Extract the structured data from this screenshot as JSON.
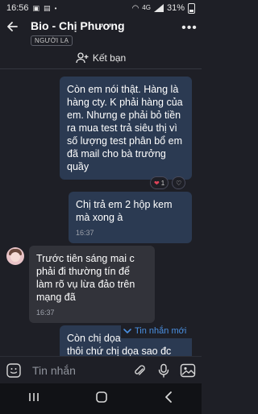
{
  "status_bar": {
    "time": "16:56",
    "battery": "31%",
    "network": "4G"
  },
  "header": {
    "title": "Bio - Chị Phương",
    "badge": "NGƯỜI LẠ"
  },
  "friend_bar": {
    "label": "Kết bạn"
  },
  "messages": [
    {
      "direction": "out",
      "text": "Còn em nói thật. Hàng là hàng cty. K phải hàng của em. Nhưng e phải bỏ tiền ra mua test trả siêu thị vì số lượng test phân bổ em đã mail cho bà trưởng quầy",
      "time": "",
      "reaction_count": "1"
    },
    {
      "direction": "out",
      "text": "Chị trả em 2 hộp kem mà xong à",
      "time": "16:37"
    },
    {
      "direction": "in",
      "text": "Trước tiên sáng mai c phải đi thường tín để làm rõ vụ lừa đảo trên mạng đã",
      "time": "16:37"
    },
    {
      "direction": "out",
      "text": "Còn chị dọa",
      "text_line2": "thôi chứ chị dọa sao đc"
    }
  ],
  "new_message_indicator": "Tin nhắn mới",
  "composer": {
    "placeholder": "Tin nhắn"
  },
  "colors": {
    "background": "#1e1f26",
    "bubble_out": "#2b3a52",
    "bubble_in": "#32333a",
    "accent": "#4a90e2"
  }
}
